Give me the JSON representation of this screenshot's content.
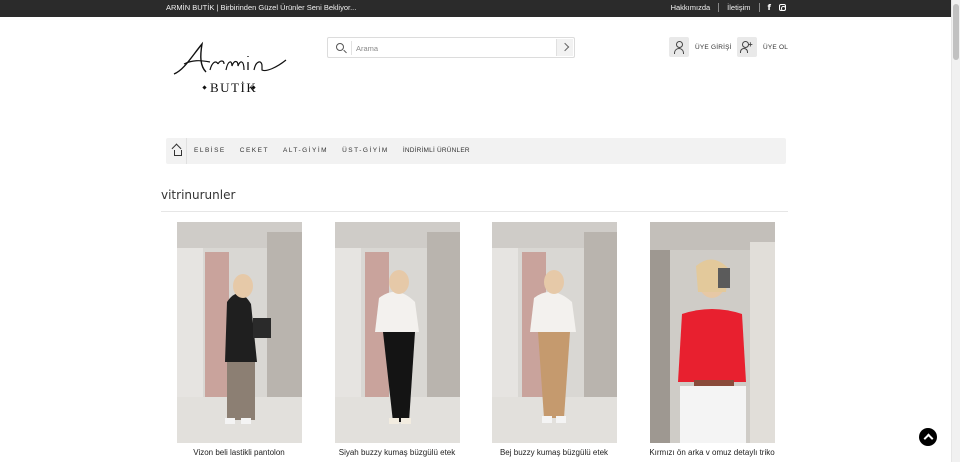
{
  "topbar": {
    "welcome": "ARMİN BUTİK | Birbirinden Güzel Ürünler Seni Bekliyor...",
    "links": [
      "Hakkımızda",
      "İletişim"
    ],
    "social": [
      "facebook-icon",
      "instagram-icon"
    ]
  },
  "logo": {
    "script": "Armin",
    "sub": "BUTİK"
  },
  "search": {
    "placeholder": "Arama"
  },
  "account": {
    "login": "ÜYE GİRİŞİ",
    "register": "ÜYE OL"
  },
  "nav": {
    "items": [
      "ELBİSE",
      "CEKET",
      "ALT-GİYİM",
      "ÜST-GİYİM",
      "İNDİRİMLİ ÜRÜNLER"
    ]
  },
  "section": {
    "title": "vitrinurunler"
  },
  "products": [
    {
      "name": "Vizon beli lastikli pantolon"
    },
    {
      "name": "Siyah buzzy kumaş büzgülü etek"
    },
    {
      "name": "Bej buzzy kumaş büzgülü etek"
    },
    {
      "name": "Kırmızı ön arka v omuz detaylı triko"
    }
  ],
  "colors": {
    "topbar": "#2b2b2b",
    "nav": "#f2f2f2",
    "accent": "#000000"
  }
}
